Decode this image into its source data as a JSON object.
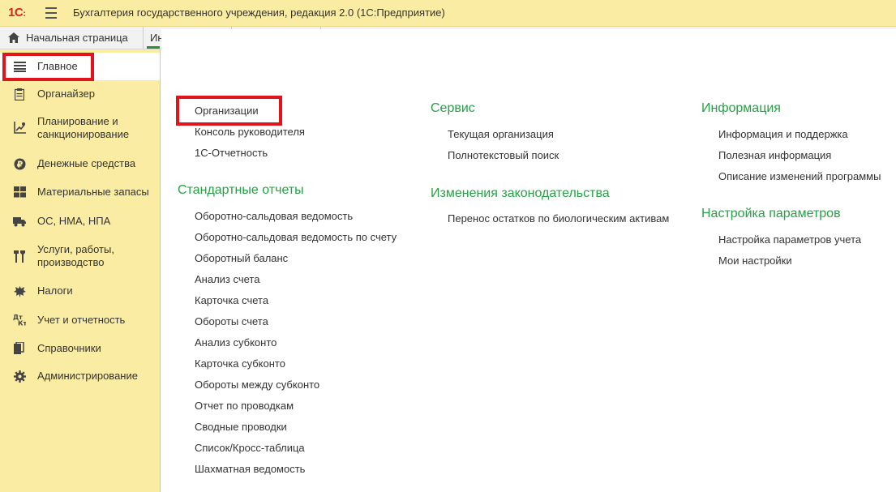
{
  "app": {
    "logo_main": "1С",
    "logo_sub": ":",
    "title": "Бухгалтерия государственного учреждения, редакция 2.0  (1С:Предприятие)"
  },
  "tabs": {
    "home_label": "Начальная страница",
    "other_label": "Ин"
  },
  "sidebar": {
    "items": [
      {
        "label": "Главное",
        "icon": "list-lines-icon"
      },
      {
        "label": "Органайзер",
        "icon": "clipboard-icon"
      },
      {
        "label": "Планирование и санкционирование",
        "icon": "chart-icon"
      },
      {
        "label": "Денежные средства",
        "icon": "ruble-coin-icon"
      },
      {
        "label": "Материальные запасы",
        "icon": "grid-icon"
      },
      {
        "label": "ОС, НМА, НПА",
        "icon": "truck-icon"
      },
      {
        "label": "Услуги, работы, производство",
        "icon": "tools-icon"
      },
      {
        "label": "Налоги",
        "icon": "emblem-icon"
      },
      {
        "label": "Учет и отчетность",
        "icon": "dt-kt-icon"
      },
      {
        "label": "Справочники",
        "icon": "books-icon"
      },
      {
        "label": "Администрирование",
        "icon": "gear-icon"
      }
    ]
  },
  "main": {
    "col1_links": [
      "Организации",
      "Консоль руководителя",
      "1С-Отчетность"
    ],
    "std_reports": {
      "title": "Стандартные отчеты",
      "items": [
        "Оборотно-сальдовая ведомость",
        "Оборотно-сальдовая ведомость по счету",
        "Оборотный баланс",
        "Анализ счета",
        "Карточка счета",
        "Обороты счета",
        "Анализ субконто",
        "Карточка субконто",
        "Обороты между субконто",
        "Отчет по проводкам",
        "Сводные проводки",
        "Список/Кросс-таблица",
        "Шахматная ведомость"
      ]
    },
    "service": {
      "title": "Сервис",
      "items": [
        "Текущая организация",
        "Полнотекстовый поиск"
      ]
    },
    "law": {
      "title": "Изменения законодательства",
      "items": [
        "Перенос остатков по биологическим активам"
      ]
    },
    "info": {
      "title": "Информация",
      "items": [
        "Информация и поддержка",
        "Полезная информация",
        "Описание изменений программы"
      ]
    },
    "settings": {
      "title": "Настройка параметров",
      "items": [
        "Настройка параметров учета",
        "Мои настройки"
      ]
    }
  },
  "colors": {
    "accent_green": "#27a046",
    "sidebar_bg": "#fbeca4",
    "highlight_red": "#e1141e"
  }
}
